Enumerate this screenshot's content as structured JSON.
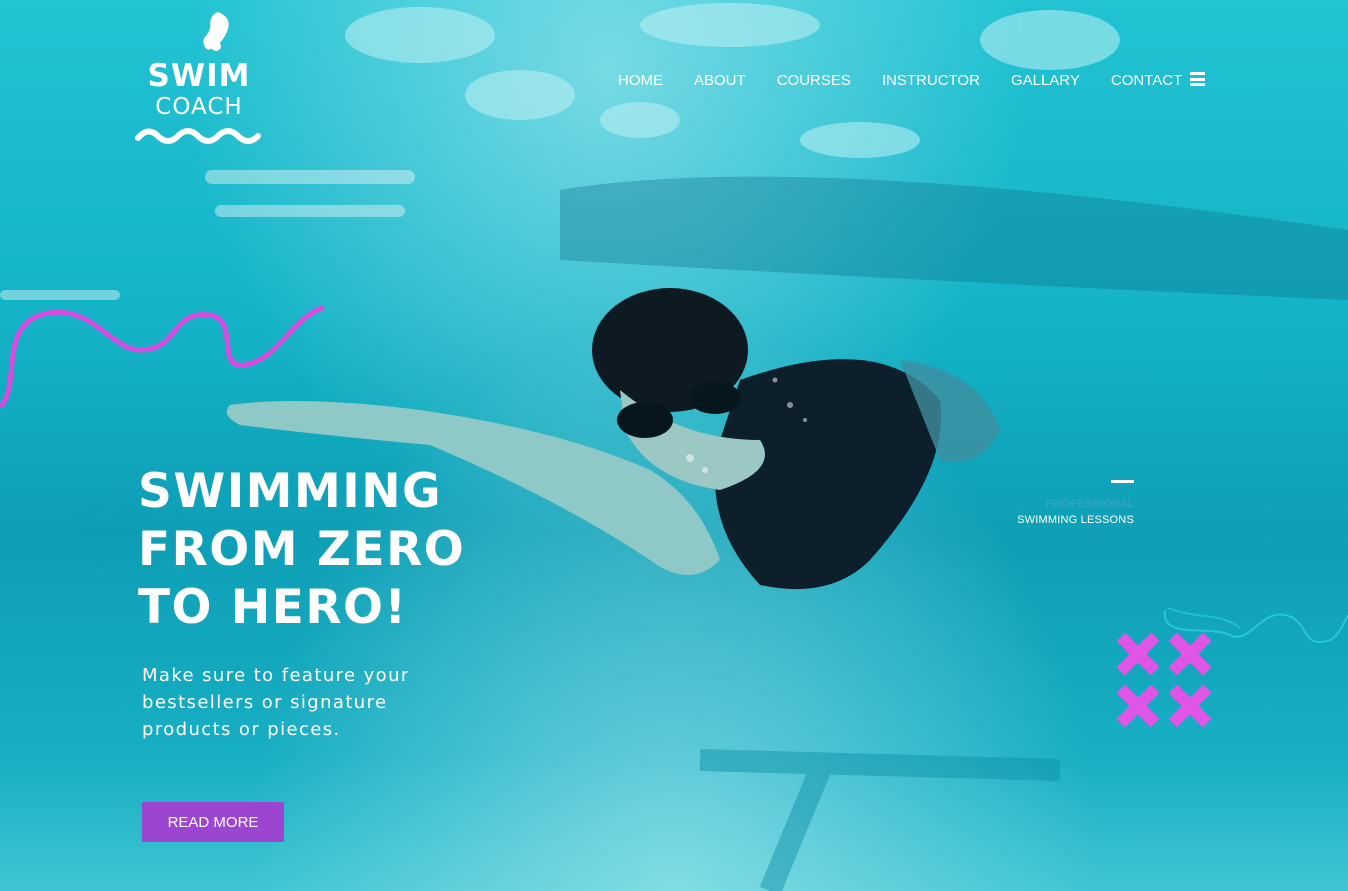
{
  "logo": {
    "line1": "SWIM",
    "line2": "COACH"
  },
  "nav": {
    "items": [
      "HOME",
      "ABOUT",
      "COURSES",
      "INSTRUCTOR",
      "GALLARY",
      "CONTACT"
    ]
  },
  "side_label": {
    "top": "PROFESSIONAL",
    "bottom": "SWIMMING LESSONS"
  },
  "hero": {
    "headline": [
      "SWIMMING",
      "FROM ZERO",
      "TO HERO!"
    ],
    "subtext": "Make sure to feature your bestsellers or signature products or pieces.",
    "button_label": "READ MORE"
  },
  "colors": {
    "water": "#14b3c7",
    "accent_purple": "#9b45d1",
    "accent_magenta": "#e054e6",
    "side_label_blue": "#3aa7c6"
  },
  "icons": {
    "menu": "hamburger-menu-icon",
    "logo_drop": "water-drop-icon",
    "logo_wave": "wave-icon"
  }
}
